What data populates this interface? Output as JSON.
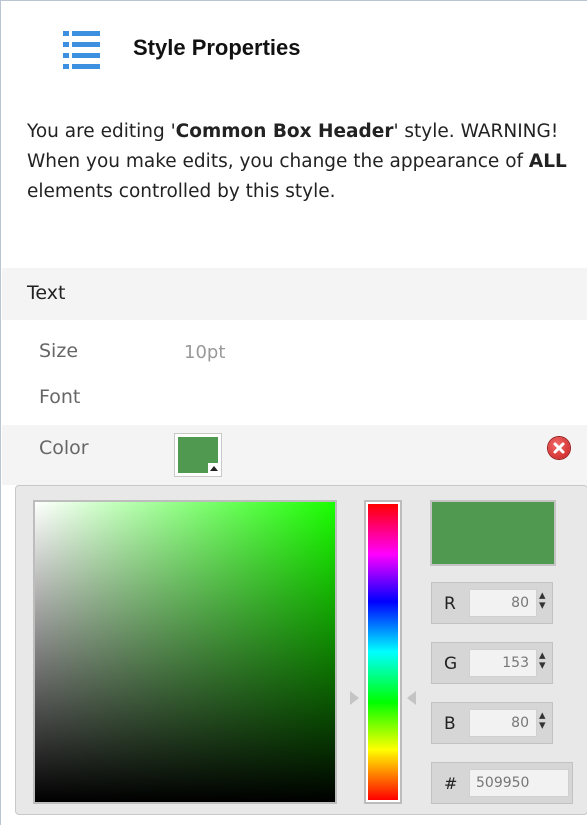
{
  "header": {
    "title": "Style Properties",
    "icon": "list-icon"
  },
  "description": {
    "p1": "You are editing '",
    "style_name": "Common Box Header",
    "p2": "' style.",
    "warning": "WARNING! When you make edits, you change the appearance of ",
    "all": "ALL",
    "p3": " elements controlled by this style."
  },
  "section": {
    "label": "Text"
  },
  "properties": {
    "size_label": "Size",
    "size_value": "10pt",
    "font_label": "Font",
    "color_label": "Color"
  },
  "color_picker": {
    "color": "#509950",
    "hue_color": "#1aff00",
    "channels": [
      {
        "label": "R",
        "value": "80"
      },
      {
        "label": "G",
        "value": "153"
      },
      {
        "label": "B",
        "value": "80"
      }
    ],
    "hex_label": "#",
    "hex_value": "509950"
  }
}
